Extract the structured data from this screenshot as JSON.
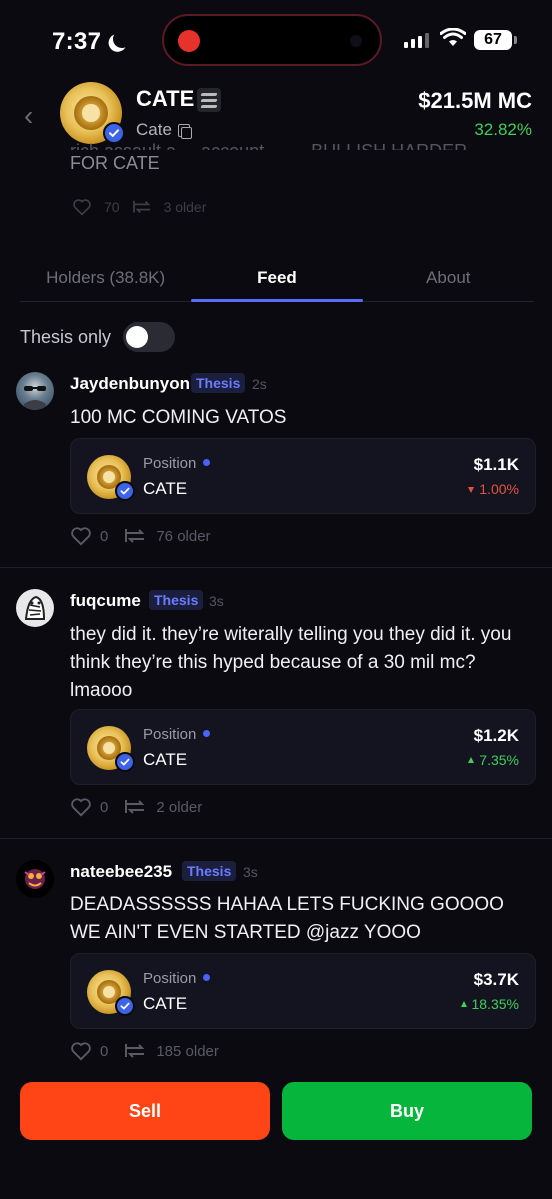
{
  "status_bar": {
    "time": "7:37",
    "battery": "67"
  },
  "token": {
    "name": "CATE",
    "ticker": "Cate",
    "market_cap": "$21.5M MC",
    "change": "32.82%",
    "change_color": "#3fcf5a"
  },
  "pinned_ghost": {
    "clipped_line": "rich assault a ... account · ... · BULLISH HARDER",
    "line2": "FOR CATE",
    "likes": "70",
    "older": "3 older"
  },
  "tabs": [
    {
      "label": "Holders (38.8K)"
    },
    {
      "label": "Feed"
    },
    {
      "label": "About"
    }
  ],
  "filter": {
    "label": "Thesis only"
  },
  "posts": [
    {
      "username": "Jaydenbunyon",
      "tag": "Thesis",
      "ago": "2s",
      "text": "100 MC COMING VATOS",
      "position": {
        "label": "Position",
        "ticker": "CATE",
        "value": "$1.1K",
        "change": "1.00%",
        "direction": "down"
      },
      "likes": "0",
      "older": "76 older"
    },
    {
      "username": "fuqcume",
      "tag": "Thesis",
      "ago": "3s",
      "text": "they did it. they’re witerally telling you they did it. you think they’re this hyped because of a 30 mil mc? lmaooo",
      "position": {
        "label": "Position",
        "ticker": "CATE",
        "value": "$1.2K",
        "change": "7.35%",
        "direction": "up"
      },
      "likes": "0",
      "older": "2 older"
    },
    {
      "username": "nateebee235",
      "tag": "Thesis",
      "ago": "3s",
      "text": "DEADASSSSSS HAHAA LETS FUCKING GOOOO WE AIN'T EVEN STARTED @jazz YOOO",
      "position": {
        "label": "Position",
        "ticker": "CATE",
        "value": "$3.7K",
        "change": "18.35%",
        "direction": "up"
      },
      "likes": "0",
      "older": "185 older"
    }
  ],
  "actions": {
    "sell": "Sell",
    "buy": "Buy",
    "sell_color": "#ff4416",
    "buy_color": "#05b53c"
  }
}
